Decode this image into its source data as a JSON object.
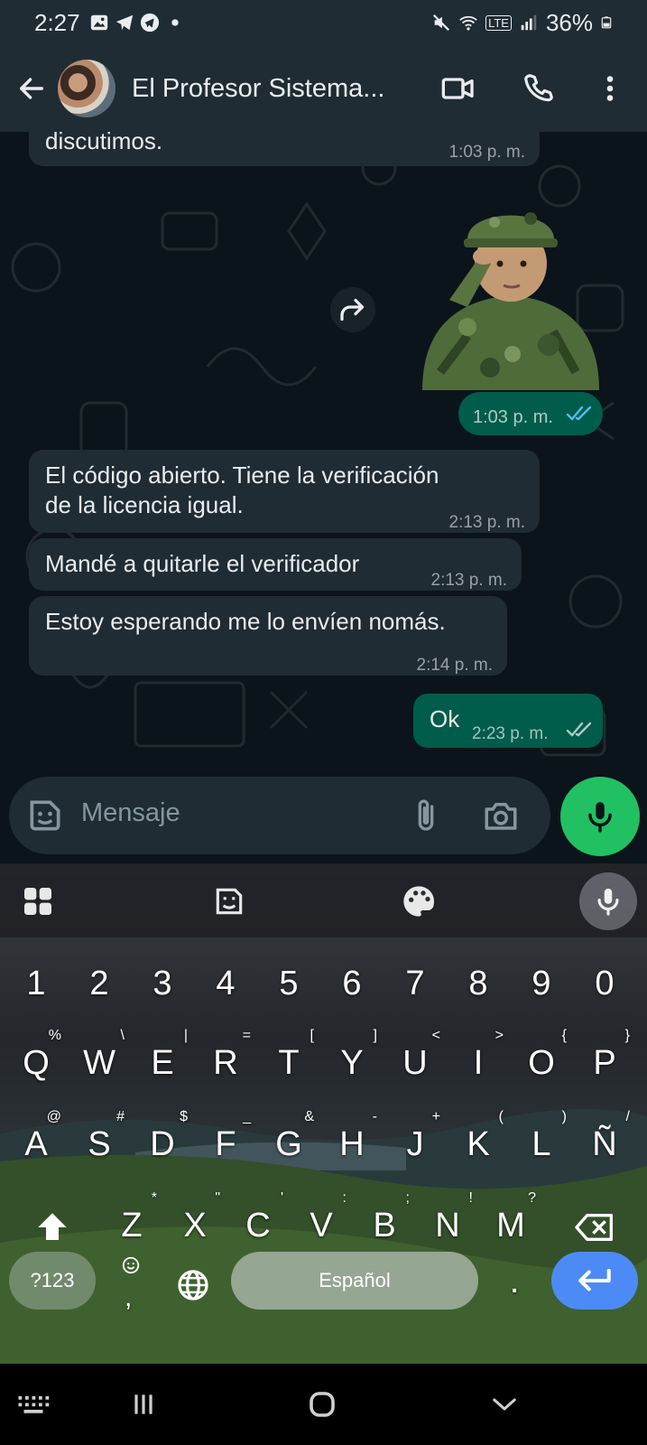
{
  "status_bar": {
    "time": "2:27",
    "battery": "36%",
    "network": "LTE"
  },
  "header": {
    "title": "El Profesor Sistema...",
    "icons": [
      "back-arrow-icon",
      "video-call-icon",
      "phone-icon",
      "more-vert-icon"
    ]
  },
  "messages": [
    {
      "direction": "in",
      "lines": [
        "discutimos."
      ],
      "time": "1:03 p. m."
    },
    {
      "direction": "out",
      "type": "sticker",
      "time": "1:03 p. m.",
      "status": "read"
    },
    {
      "direction": "in",
      "lines": [
        "El código abierto. Tiene la verificación",
        "de la licencia igual."
      ],
      "time": "2:13 p. m."
    },
    {
      "direction": "in",
      "lines": [
        "Mandé a quitarle el verificador"
      ],
      "time": "2:13 p. m."
    },
    {
      "direction": "in",
      "lines": [
        "Estoy esperando me lo envíen nomás."
      ],
      "time": "2:14 p. m."
    },
    {
      "direction": "out",
      "lines": [
        "Ok"
      ],
      "time": "2:23 p. m.",
      "status": "delivered"
    }
  ],
  "composer": {
    "placeholder": "Mensaje"
  },
  "keyboard": {
    "number_row": [
      "1",
      "2",
      "3",
      "4",
      "5",
      "6",
      "7",
      "8",
      "9",
      "0"
    ],
    "row1": [
      "Q",
      "W",
      "E",
      "R",
      "T",
      "Y",
      "U",
      "I",
      "O",
      "P"
    ],
    "row1_hints": [
      "%",
      "\\",
      "|",
      "=",
      "[",
      "]",
      "<",
      ">",
      "{",
      "}"
    ],
    "row2": [
      "A",
      "S",
      "D",
      "F",
      "G",
      "H",
      "J",
      "K",
      "L",
      "Ñ"
    ],
    "row2_hints": [
      "@",
      "#",
      "$",
      "_",
      "&",
      "-",
      "+",
      "(",
      ")",
      "/"
    ],
    "row3": [
      "Z",
      "X",
      "C",
      "V",
      "B",
      "N",
      "M"
    ],
    "row3_hints": [
      "*",
      "\"",
      "'",
      ":",
      ";",
      "!",
      "?"
    ],
    "symbols_key": "?123",
    "emoji_comma_hint": ",",
    "space_label": "Español",
    "period_key": "."
  },
  "colors": {
    "incoming_bubble": "#1f2c34",
    "outgoing_bubble": "#005c4b",
    "accent_green": "#21c063",
    "read_ticks": "#53bdeb",
    "enter_key": "#4c8bf5"
  }
}
